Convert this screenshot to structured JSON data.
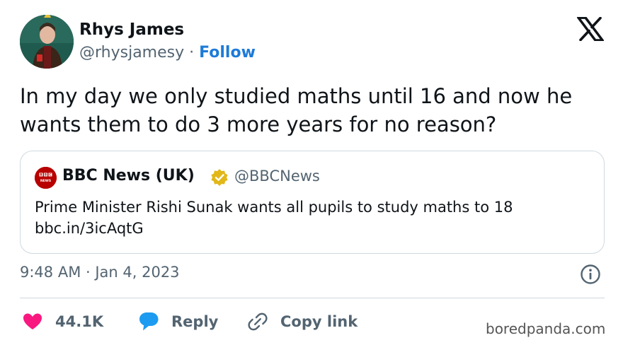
{
  "author": {
    "name": "Rhys James",
    "handle": "@rhysjamesy",
    "separator": "·",
    "follow_label": "Follow"
  },
  "tweet": {
    "text": "In my day we only studied maths until 16 and now he wants them to do 3 more years for no reason?"
  },
  "quote": {
    "logo_text_top": "BBC",
    "logo_text_bottom": "NEWS",
    "name": "BBC News (UK)",
    "handle": "@BBCNews",
    "text_line1": "Prime Minister Rishi Sunak wants all pupils to study maths to 18",
    "text_line2": "bbc.in/3icAqtG"
  },
  "meta": {
    "timestamp": "9:48 AM · Jan 4, 2023"
  },
  "actions": {
    "likes": "44.1K",
    "reply_label": "Reply",
    "copy_label": "Copy link"
  },
  "watermark": "boredpanda.com",
  "colors": {
    "text": "#0f1419",
    "muted": "#536471",
    "link": "#1d7bd8",
    "like": "#f91880",
    "reply": "#1d9bf0",
    "bbc": "#b80000",
    "verified": "#e2b719"
  },
  "icons": {
    "brand": "x-logo-icon",
    "verified": "verified-badge-icon",
    "info": "info-icon",
    "like": "heart-icon",
    "reply": "speech-bubble-icon",
    "copy": "link-icon"
  }
}
